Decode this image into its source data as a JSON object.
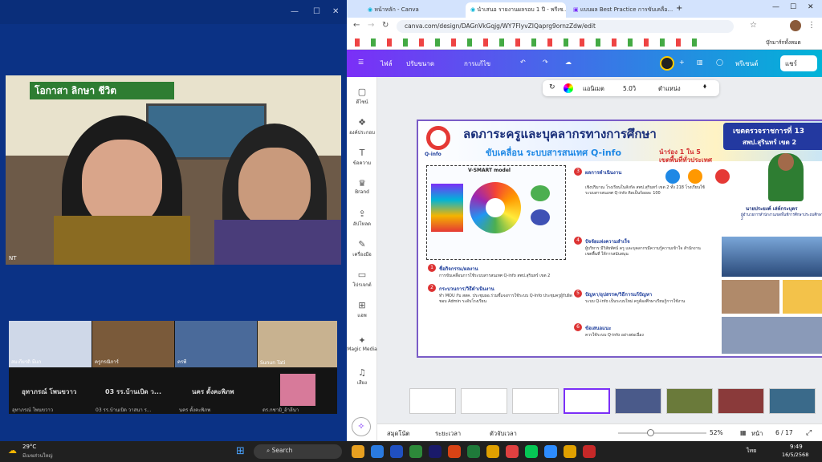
{
  "left": {
    "main_label": "NT",
    "tiles": [
      {
        "label": "สมเกียรติ มีแก"
      },
      {
        "label": "ครูกรณิการ์"
      },
      {
        "label": "ครพี"
      },
      {
        "label": "Sunun Tati"
      }
    ],
    "names": [
      "อุทาภรณ์ โพนขวาว",
      "03 รร.บ้านเบิด ว...",
      "นคร ตั้งคะพิภพ"
    ],
    "small_names": [
      "อุทาภรณ์ โพนขวาว",
      "03 รร.บ้านเบิด วาสนา ร...",
      "นคร ตั้งคะพิภพ",
      "ดร.กชามิ_อ้าลีนา"
    ]
  },
  "browser": {
    "tabs": [
      {
        "label": "หน้าหลัก - Canva"
      },
      {
        "label": "นำเสนอ รายงานผลรอบ 1 ปี - พรีเซ..."
      },
      {
        "label": "แบบผล Best Practice การขับเคลื่อ..."
      }
    ],
    "url": "canva.com/design/DAGnVkGqjg/WY7FIyvZIQaprg9ornzZdw/edit",
    "bookmark_right": "บุ๊กมาร์กทั้งหมด",
    "canva": {
      "file": "ไฟล์",
      "resize": "ปรับขนาด",
      "edit": "การแก้ไข",
      "present": "พรีเซนต์",
      "share": "แชร์"
    },
    "ctx": {
      "anim": "แอนิเมต",
      "time": "5.0วิ",
      "position": "ตำแหน่ง"
    },
    "sidebar": [
      "ดีไซน์",
      "องค์ประกอบ",
      "ข้อความ",
      "Brand",
      "อัปโหลด",
      "เครื่องมือ",
      "โปรเจกต์",
      "แอพ",
      "Magic Media",
      "เสียง"
    ],
    "slide": {
      "title": "ลดภาระครูและบุคลากรทางการศึกษา",
      "logo": "Q-info",
      "subtitle": "ขับเคลื่อน ระบบสารสนเทศ Q-info",
      "region": "เขตตรวจราชการที่ 13",
      "office": "สพป.สุรินทร์ เขต 2",
      "rank1": "นำร่อง 1 ใน 5",
      "rank2": "เขตพื้นที่ทั่วประเทศ",
      "model": "V-SMART model",
      "person": "นายประยงค์ เล่ห์กระบุตร",
      "person_title": "ผู้อำนวยการสำนักงานเขตพื้นที่การศึกษาประถมศึกษาสุรินทร์ เขต 2",
      "sections": [
        {
          "n": "1",
          "h": "ชื่อกิจกรรม/ผลงาน",
          "t": "การขับเคลื่อนการใช้ระบบสารสนเทศ Q-info สพป.สุรินทร์ เขต 2"
        },
        {
          "n": "2",
          "h": "กระบวนการ/วิธีดำเนินงาน",
          "t": "ทำ MOU กับ สสค. ประชุมผอ.ร่วมชี้แจงการใช้ระบบ Q-Info ประชุมครูผู้รับผิดชอบ Admin ระดับโรงเรียน"
        },
        {
          "n": "3",
          "h": "ผลการดำเนินงาน",
          "t": "เชิงปริมาณ โรงเรียนในสังกัด สพป.สุรินทร์ เขต 2 ทั้ง 218 โรงเรียนใช้ระบบสารสนเทศ Q-info คิดเป็นร้อยละ 100"
        },
        {
          "n": "4",
          "h": "ปัจจัยแห่งความสำเร็จ",
          "t": "ผู้บริหาร มีวิสัยทัศน์ ครู และบุคลากรมีความรู้ความเข้าใจ สำนักงานเขตพื้นที่ ให้การสนับสนุน"
        },
        {
          "n": "5",
          "h": "ปัญหา/อุปสรรค/วิธีการแก้ปัญหา",
          "t": "ระบบ Q-info เป็นระบบใหม่ ครูต้องศึกษาเรียนรู้การใช้งาน"
        },
        {
          "n": "6",
          "h": "ข้อเสนอแนะ",
          "t": "ควรใช้ระบบ Q-info อย่างต่อเนื่อง"
        }
      ]
    },
    "footer": {
      "notes": "สมุดโน้ต",
      "time": "ระยะเวลา",
      "timer": "ตัวจับเวลา",
      "zoom": "52%",
      "pages": "หน้า",
      "page_count": "6 / 17"
    }
  },
  "taskbar": {
    "weather_temp": "29°C",
    "weather_text": "มีเมฆส่วนใหญ่",
    "search": "Search",
    "lang": "ไทย",
    "time": "9:49",
    "date": "16/5/2568"
  }
}
